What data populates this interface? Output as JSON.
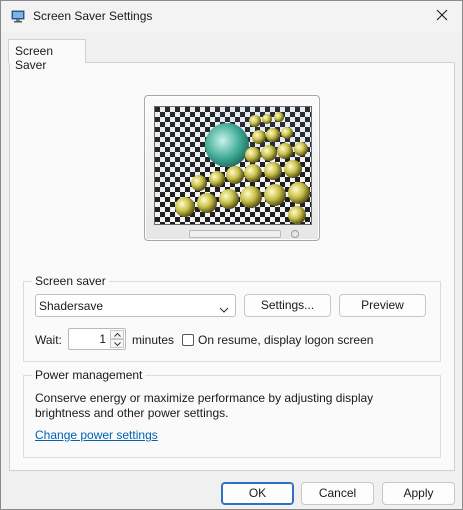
{
  "window": {
    "title": "Screen Saver Settings",
    "app_icon": "display-settings-icon",
    "close_icon": "close-icon"
  },
  "tabs": [
    {
      "label": "Screen Saver",
      "active": true
    }
  ],
  "preview": {
    "icon": "monitor-preview-icon"
  },
  "screen_saver": {
    "group_label": "Screen saver",
    "selected": "Shadersave",
    "settings_label": "Settings...",
    "preview_label": "Preview",
    "wait_label": "Wait:",
    "wait_value": "1",
    "minutes_label": "minutes",
    "logon_label": "On resume, display logon screen",
    "logon_checked": false
  },
  "power": {
    "group_label": "Power management",
    "description": "Conserve energy or maximize performance by adjusting display brightness and other power settings.",
    "link_label": "Change power settings"
  },
  "footer": {
    "ok_label": "OK",
    "cancel_label": "Cancel",
    "apply_label": "Apply"
  },
  "colors": {
    "accent": "#3070c0",
    "link": "#0063b1"
  }
}
